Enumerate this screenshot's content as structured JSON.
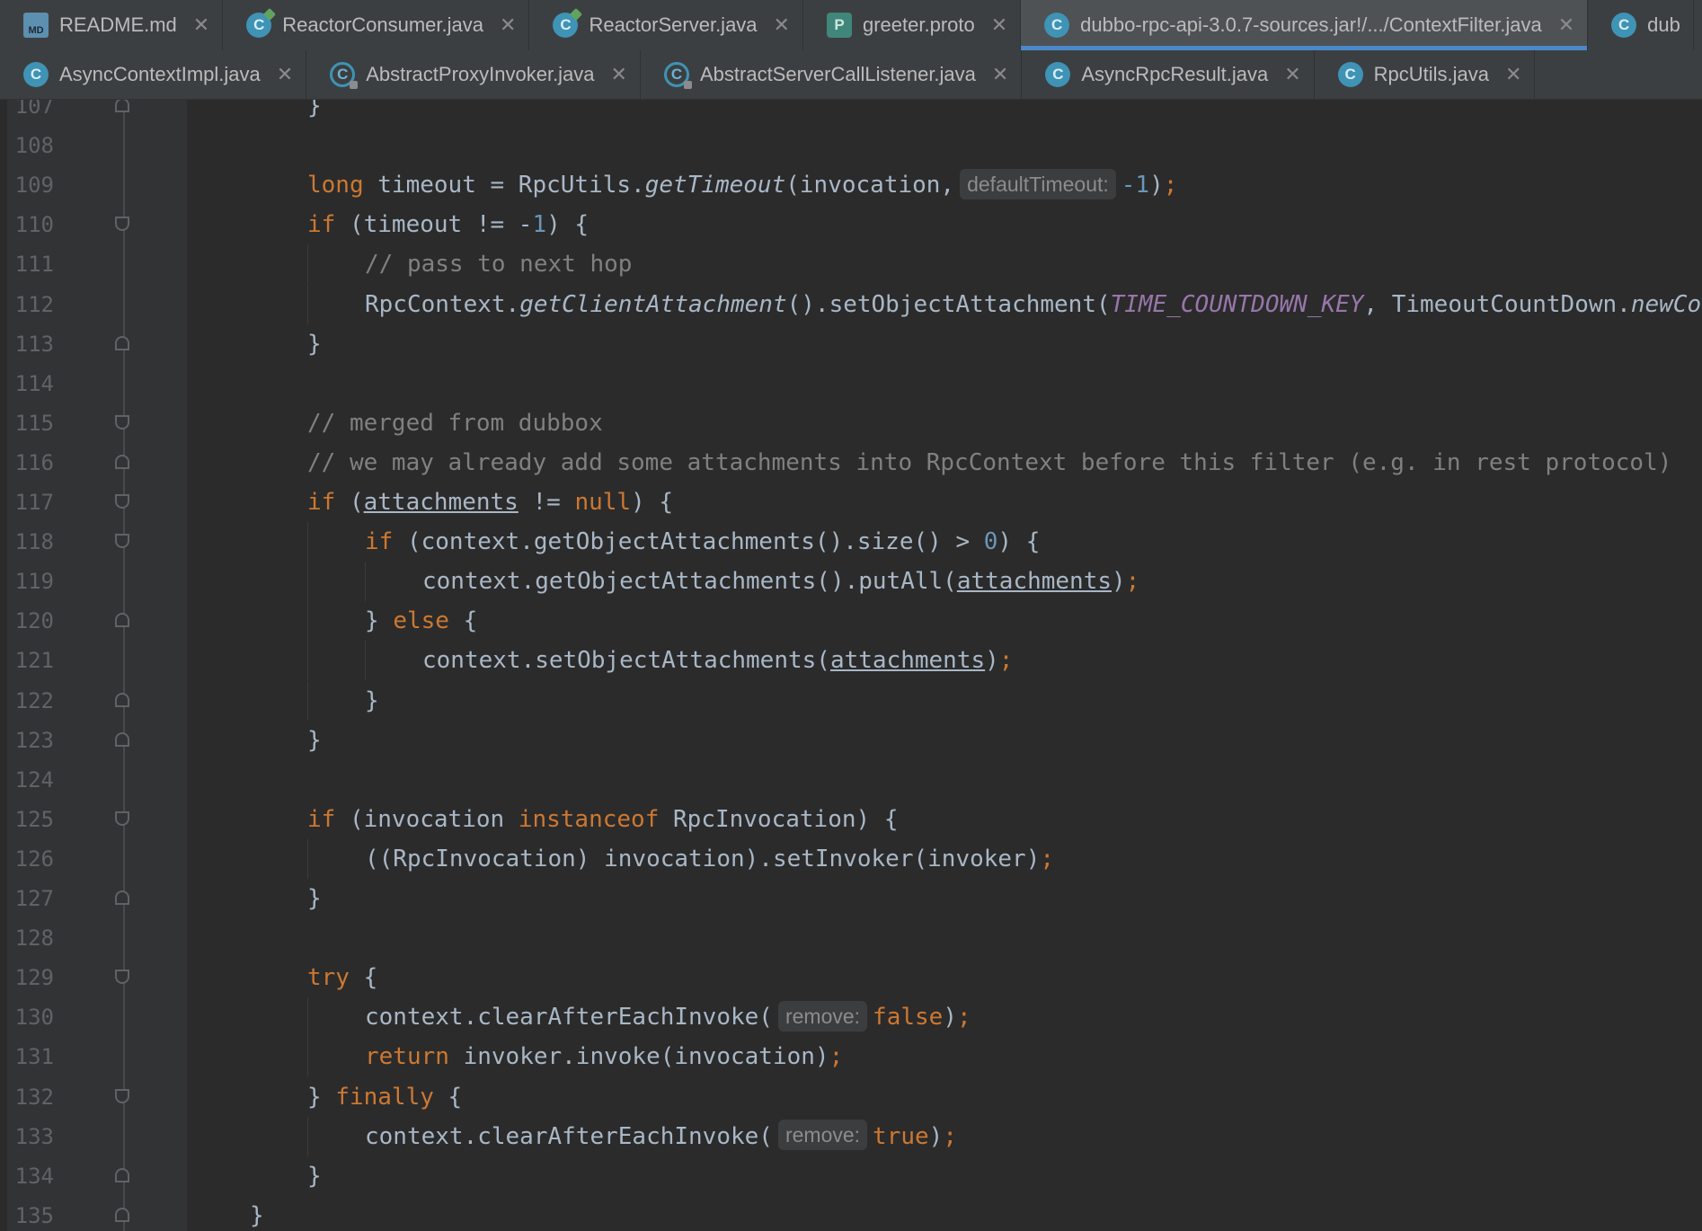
{
  "tabs_row1": [
    {
      "label": "README.md",
      "icon": "markdown-file-icon",
      "icon_text": "MD",
      "active": false
    },
    {
      "label": "ReactorConsumer.java",
      "icon": "runnable-class-icon",
      "icon_text": "C",
      "active": false
    },
    {
      "label": "ReactorServer.java",
      "icon": "runnable-class-icon",
      "icon_text": "C",
      "active": false
    },
    {
      "label": "greeter.proto",
      "icon": "proto-file-icon",
      "icon_text": "P",
      "active": false
    },
    {
      "label": "dubbo-rpc-api-3.0.7-sources.jar!/.../ContextFilter.java",
      "icon": "class-icon",
      "icon_text": "C",
      "active": true
    },
    {
      "label": "dub",
      "icon": "class-icon",
      "icon_text": "C",
      "active": false
    }
  ],
  "tabs_row2": [
    {
      "label": "AsyncContextImpl.java",
      "icon": "class-icon",
      "icon_text": "C"
    },
    {
      "label": "AbstractProxyInvoker.java",
      "icon": "locked-class-icon",
      "icon_text": "C"
    },
    {
      "label": "AbstractServerCallListener.java",
      "icon": "locked-class-icon",
      "icon_text": "C"
    },
    {
      "label": "AsyncRpcResult.java",
      "icon": "class-icon",
      "icon_text": "C"
    },
    {
      "label": "RpcUtils.java",
      "icon": "class-icon",
      "icon_text": "C"
    }
  ],
  "close_glyph": "✕",
  "colors": {
    "keyword": "#cc7832",
    "number": "#6897bb",
    "comment": "#808080",
    "static": "#9876aa",
    "text": "#a9b7c6",
    "accent": "#4a88c7"
  },
  "code_lines": [
    {
      "n": "107",
      "fold": "close",
      "indent": 1,
      "tokens": [
        {
          "t": "}"
        }
      ]
    },
    {
      "n": "108",
      "fold": "",
      "indent": 0,
      "tokens": []
    },
    {
      "n": "109",
      "fold": "",
      "indent": 1,
      "tokens": [
        {
          "t": "long",
          "c": "kw"
        },
        {
          "t": " timeout = RpcUtils."
        },
        {
          "t": "getTimeout",
          "c": "it"
        },
        {
          "t": "(invocation,"
        },
        {
          "t": "defaultTimeout:",
          "c": "hint"
        },
        {
          "t": "-1",
          "c": "num"
        },
        {
          "t": ")"
        },
        {
          "t": ";",
          "c": "kw"
        }
      ]
    },
    {
      "n": "110",
      "fold": "open",
      "indent": 1,
      "tokens": [
        {
          "t": "if",
          "c": "kw"
        },
        {
          "t": " (timeout != -"
        },
        {
          "t": "1",
          "c": "num"
        },
        {
          "t": ") {"
        }
      ]
    },
    {
      "n": "111",
      "fold": "",
      "indent": 2,
      "tokens": [
        {
          "t": "// pass to next hop",
          "c": "cm"
        }
      ]
    },
    {
      "n": "112",
      "fold": "",
      "indent": 2,
      "tokens": [
        {
          "t": "RpcContext."
        },
        {
          "t": "getClientAttachment",
          "c": "it"
        },
        {
          "t": "().setObjectAttachment("
        },
        {
          "t": "TIME_COUNTDOWN_KEY",
          "c": "st"
        },
        {
          "t": ", TimeoutCountDown."
        },
        {
          "t": "newCountDown",
          "c": "it"
        }
      ]
    },
    {
      "n": "113",
      "fold": "close",
      "indent": 1,
      "tokens": [
        {
          "t": "}"
        }
      ]
    },
    {
      "n": "114",
      "fold": "",
      "indent": 0,
      "tokens": []
    },
    {
      "n": "115",
      "fold": "open",
      "indent": 1,
      "tokens": [
        {
          "t": "// merged from dubbox",
          "c": "cm"
        }
      ]
    },
    {
      "n": "116",
      "fold": "close",
      "indent": 1,
      "tokens": [
        {
          "t": "// we may already add some attachments into RpcContext before this filter (e.g. in rest protocol)",
          "c": "cm"
        }
      ]
    },
    {
      "n": "117",
      "fold": "open",
      "indent": 1,
      "tokens": [
        {
          "t": "if",
          "c": "kw"
        },
        {
          "t": " ("
        },
        {
          "t": "attachments",
          "c": "ul"
        },
        {
          "t": " != "
        },
        {
          "t": "null",
          "c": "kw"
        },
        {
          "t": ") {"
        }
      ]
    },
    {
      "n": "118",
      "fold": "open",
      "indent": 2,
      "tokens": [
        {
          "t": "if",
          "c": "kw"
        },
        {
          "t": " (context.getObjectAttachments().size() > "
        },
        {
          "t": "0",
          "c": "num"
        },
        {
          "t": ") {"
        }
      ]
    },
    {
      "n": "119",
      "fold": "",
      "indent": 3,
      "tokens": [
        {
          "t": "context.getObjectAttachments().putAll("
        },
        {
          "t": "attachments",
          "c": "ul"
        },
        {
          "t": ")"
        },
        {
          "t": ";",
          "c": "kw"
        }
      ]
    },
    {
      "n": "120",
      "fold": "close",
      "indent": 2,
      "tokens": [
        {
          "t": "} "
        },
        {
          "t": "else",
          "c": "kw"
        },
        {
          "t": " {"
        }
      ]
    },
    {
      "n": "121",
      "fold": "",
      "indent": 3,
      "tokens": [
        {
          "t": "context.setObjectAttachments("
        },
        {
          "t": "attachments",
          "c": "ul"
        },
        {
          "t": ")"
        },
        {
          "t": ";",
          "c": "kw"
        }
      ]
    },
    {
      "n": "122",
      "fold": "close",
      "indent": 2,
      "tokens": [
        {
          "t": "}"
        }
      ]
    },
    {
      "n": "123",
      "fold": "close",
      "indent": 1,
      "tokens": [
        {
          "t": "}"
        }
      ]
    },
    {
      "n": "124",
      "fold": "",
      "indent": 0,
      "tokens": []
    },
    {
      "n": "125",
      "fold": "open",
      "indent": 1,
      "tokens": [
        {
          "t": "if",
          "c": "kw"
        },
        {
          "t": " (invocation "
        },
        {
          "t": "instanceof",
          "c": "kw"
        },
        {
          "t": " RpcInvocation) {"
        }
      ]
    },
    {
      "n": "126",
      "fold": "",
      "indent": 2,
      "tokens": [
        {
          "t": "((RpcInvocation) invocation).setInvoker(invoker)"
        },
        {
          "t": ";",
          "c": "kw"
        }
      ]
    },
    {
      "n": "127",
      "fold": "close",
      "indent": 1,
      "tokens": [
        {
          "t": "}"
        }
      ]
    },
    {
      "n": "128",
      "fold": "",
      "indent": 0,
      "tokens": []
    },
    {
      "n": "129",
      "fold": "open",
      "indent": 1,
      "tokens": [
        {
          "t": "try",
          "c": "kw"
        },
        {
          "t": " {"
        }
      ]
    },
    {
      "n": "130",
      "fold": "",
      "indent": 2,
      "tokens": [
        {
          "t": "context.clearAfterEachInvoke("
        },
        {
          "t": "remove:",
          "c": "hint"
        },
        {
          "t": "false",
          "c": "kw"
        },
        {
          "t": ")"
        },
        {
          "t": ";",
          "c": "kw"
        }
      ]
    },
    {
      "n": "131",
      "fold": "",
      "indent": 2,
      "tokens": [
        {
          "t": "return",
          "c": "kw"
        },
        {
          "t": " invoker.invoke(invocation)"
        },
        {
          "t": ";",
          "c": "kw"
        }
      ]
    },
    {
      "n": "132",
      "fold": "open",
      "indent": 1,
      "tokens": [
        {
          "t": "} "
        },
        {
          "t": "finally",
          "c": "kw"
        },
        {
          "t": " {"
        }
      ]
    },
    {
      "n": "133",
      "fold": "",
      "indent": 2,
      "tokens": [
        {
          "t": "context.clearAfterEachInvoke("
        },
        {
          "t": "remove:",
          "c": "hint"
        },
        {
          "t": "true",
          "c": "kw"
        },
        {
          "t": ")"
        },
        {
          "t": ";",
          "c": "kw"
        }
      ]
    },
    {
      "n": "134",
      "fold": "close",
      "indent": 1,
      "tokens": [
        {
          "t": "}"
        }
      ]
    },
    {
      "n": "135",
      "fold": "close",
      "indent": 0,
      "tokens": [
        {
          "t": "}"
        }
      ]
    }
  ]
}
